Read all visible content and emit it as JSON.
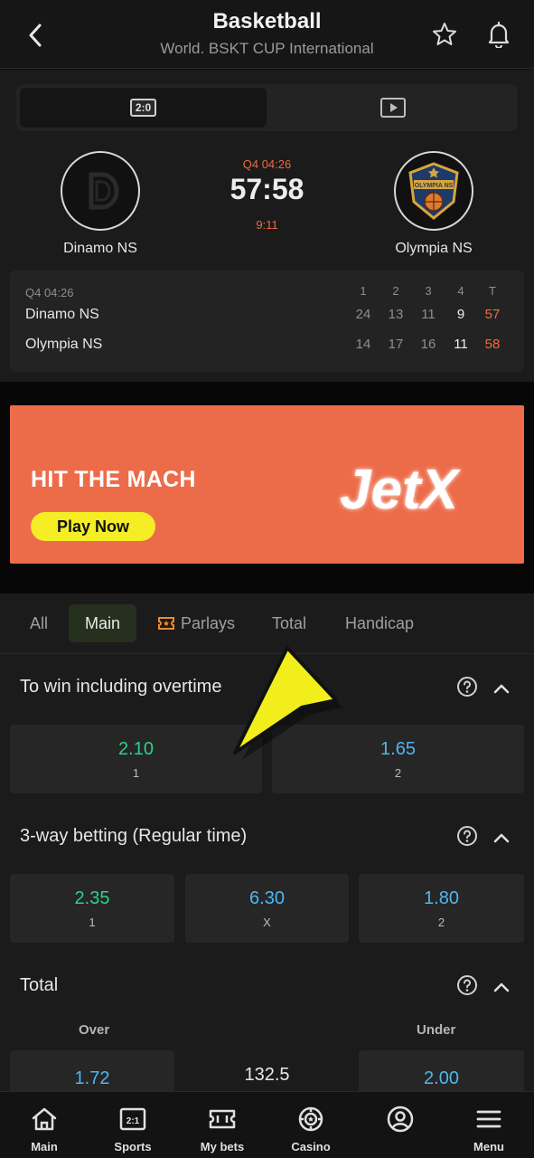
{
  "header": {
    "title": "Basketball",
    "subtitle": "World. BSKT CUP International"
  },
  "match": {
    "toggle_score_label": "2:0",
    "period_time": "Q4 04:26",
    "score": "57:58",
    "sub_clock": "9:11",
    "team1": {
      "name": "Dinamo NS"
    },
    "team2": {
      "name": "Olympia NS",
      "logo_text": "OLYMPIA NS"
    }
  },
  "scoreboard": {
    "time": "Q4 04:26",
    "headers": [
      "1",
      "2",
      "3",
      "4",
      "T"
    ],
    "rows": [
      {
        "team": "Dinamo NS",
        "values": [
          "24",
          "13",
          "11",
          "9",
          "57"
        ]
      },
      {
        "team": "Olympia NS",
        "values": [
          "14",
          "17",
          "16",
          "11",
          "58"
        ]
      }
    ]
  },
  "banner": {
    "headline": "HIT THE MACH",
    "button": "Play Now",
    "brand": "JetX"
  },
  "tabs": [
    "All",
    "Main",
    "Parlays",
    "Total",
    "Handicap"
  ],
  "active_tab": "Main",
  "markets": [
    {
      "title": "To win including overtime",
      "odds": [
        {
          "value": "2.10",
          "label": "1"
        },
        {
          "value": "1.65",
          "label": "2"
        }
      ]
    },
    {
      "title": "3-way betting (Regular time)",
      "odds": [
        {
          "value": "2.35",
          "label": "1"
        },
        {
          "value": "6.30",
          "label": "X"
        },
        {
          "value": "1.80",
          "label": "2"
        }
      ]
    },
    {
      "title": "Total",
      "over_label": "Over",
      "under_label": "Under",
      "over": "1.72",
      "line": "132.5",
      "under": "2.00"
    }
  ],
  "bottom_nav": [
    {
      "label": "Main",
      "icon": "home-icon"
    },
    {
      "label": "Sports",
      "icon": "scoreboard-icon"
    },
    {
      "label": "My bets",
      "icon": "ticket-icon"
    },
    {
      "label": "Casino",
      "icon": "chip-icon"
    },
    {
      "label": "",
      "icon": "profile-icon"
    },
    {
      "label": "Menu",
      "icon": "menu-icon"
    }
  ],
  "colors": {
    "accent_orange": "#f26a3d",
    "odd_green": "#2fd08a",
    "odd_blue": "#4fb6ee",
    "banner_bg": "#ec6c4a",
    "banner_button": "#f5ee24"
  }
}
